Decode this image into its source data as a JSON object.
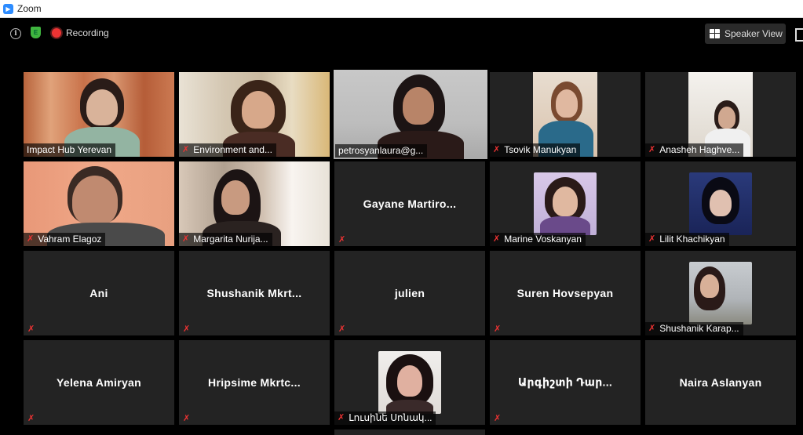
{
  "window": {
    "app_title": "Zoom"
  },
  "toolbar": {
    "recording_label": "Recording",
    "speaker_view_label": "Speaker View"
  },
  "colors": {
    "active_speaker_border": "#d6f542",
    "muted_icon": "#e33333",
    "tile_bg": "#232323",
    "recording_dot": "#e33333"
  },
  "participants": [
    {
      "name": "Impact Hub Yerevan",
      "muted": false,
      "video": true
    },
    {
      "name": "Environment and...",
      "muted": true,
      "video": true
    },
    {
      "name": "petrosyanlaura@g...",
      "muted": false,
      "video": true,
      "active_speaker": true
    },
    {
      "name": "Tsovik Manukyan",
      "muted": true,
      "video": true
    },
    {
      "name": "Anasheh Haghve...",
      "muted": true,
      "video": true
    },
    {
      "name": "Vahram Elagoz",
      "muted": true,
      "video": true
    },
    {
      "name": "Margarita Nurija...",
      "muted": true,
      "video": true
    },
    {
      "name": "Gayane  Martiro...",
      "muted": true,
      "video": false
    },
    {
      "name": "Marine Voskanyan",
      "muted": true,
      "video": false,
      "avatar": true
    },
    {
      "name": "Lilit Khachikyan",
      "muted": true,
      "video": false,
      "avatar": true
    },
    {
      "name": "Ani",
      "muted": true,
      "video": false
    },
    {
      "name": "Shushanik  Mkrt...",
      "muted": true,
      "video": false
    },
    {
      "name": "julien",
      "muted": true,
      "video": false
    },
    {
      "name": "Suren Hovsepyan",
      "muted": true,
      "video": false
    },
    {
      "name": "Shushanik Karap...",
      "muted": true,
      "video": false,
      "avatar": true
    },
    {
      "name": "Yelena Amiryan",
      "muted": true,
      "video": false
    },
    {
      "name": "Hripsime  Mkrtc...",
      "muted": true,
      "video": false
    },
    {
      "name": "Լուսինե Սոնակ...",
      "muted": true,
      "video": false,
      "avatar": true
    },
    {
      "name": "Արգիշտի Դար...",
      "muted": true,
      "video": false
    },
    {
      "name": "Naira Aslanyan",
      "muted": false,
      "video": false
    }
  ]
}
